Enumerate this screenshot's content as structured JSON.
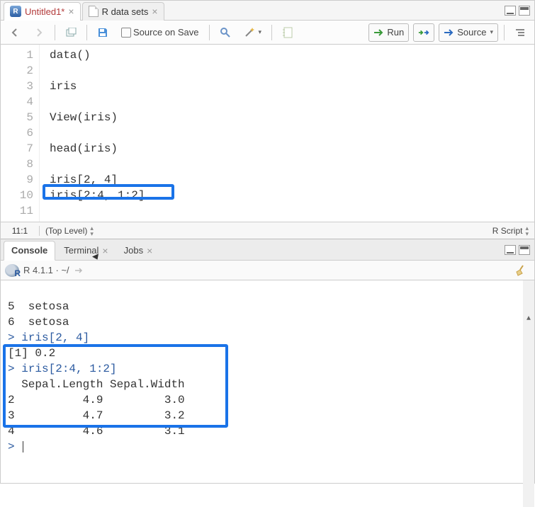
{
  "tabs": [
    {
      "title": "Untitled1*",
      "unsaved": true
    },
    {
      "title": "R data sets",
      "unsaved": false
    }
  ],
  "toolbar": {
    "source_on_save": "Source on Save",
    "run": "Run",
    "source": "Source"
  },
  "code": {
    "lines": [
      "data()",
      "",
      "iris",
      "",
      "View(iris)",
      "",
      "head(iris)",
      "",
      "iris[2, 4]",
      "iris[2:4, 1:2]",
      ""
    ]
  },
  "status": {
    "pos": "11:1",
    "scope": "(Top Level)",
    "lang": "R Script"
  },
  "console_tabs": {
    "console": "Console",
    "terminal": "Terminal",
    "jobs": "Jobs"
  },
  "console_info": "R 4.1.1 · ~/",
  "console_lines": [
    {
      "cls": "out",
      "t": "5  setosa"
    },
    {
      "cls": "out",
      "t": "6  setosa"
    },
    {
      "cls": "cmd",
      "t": "> iris[2, 4]"
    },
    {
      "cls": "out",
      "t": "[1] 0.2"
    },
    {
      "cls": "cmd",
      "t": "> iris[2:4, 1:2]"
    },
    {
      "cls": "out",
      "t": "  Sepal.Length Sepal.Width"
    },
    {
      "cls": "out",
      "t": "2          4.9         3.0"
    },
    {
      "cls": "out",
      "t": "3          4.7         3.2"
    },
    {
      "cls": "out",
      "t": "4          4.6         3.1"
    },
    {
      "cls": "cmd",
      "t": "> "
    }
  ]
}
